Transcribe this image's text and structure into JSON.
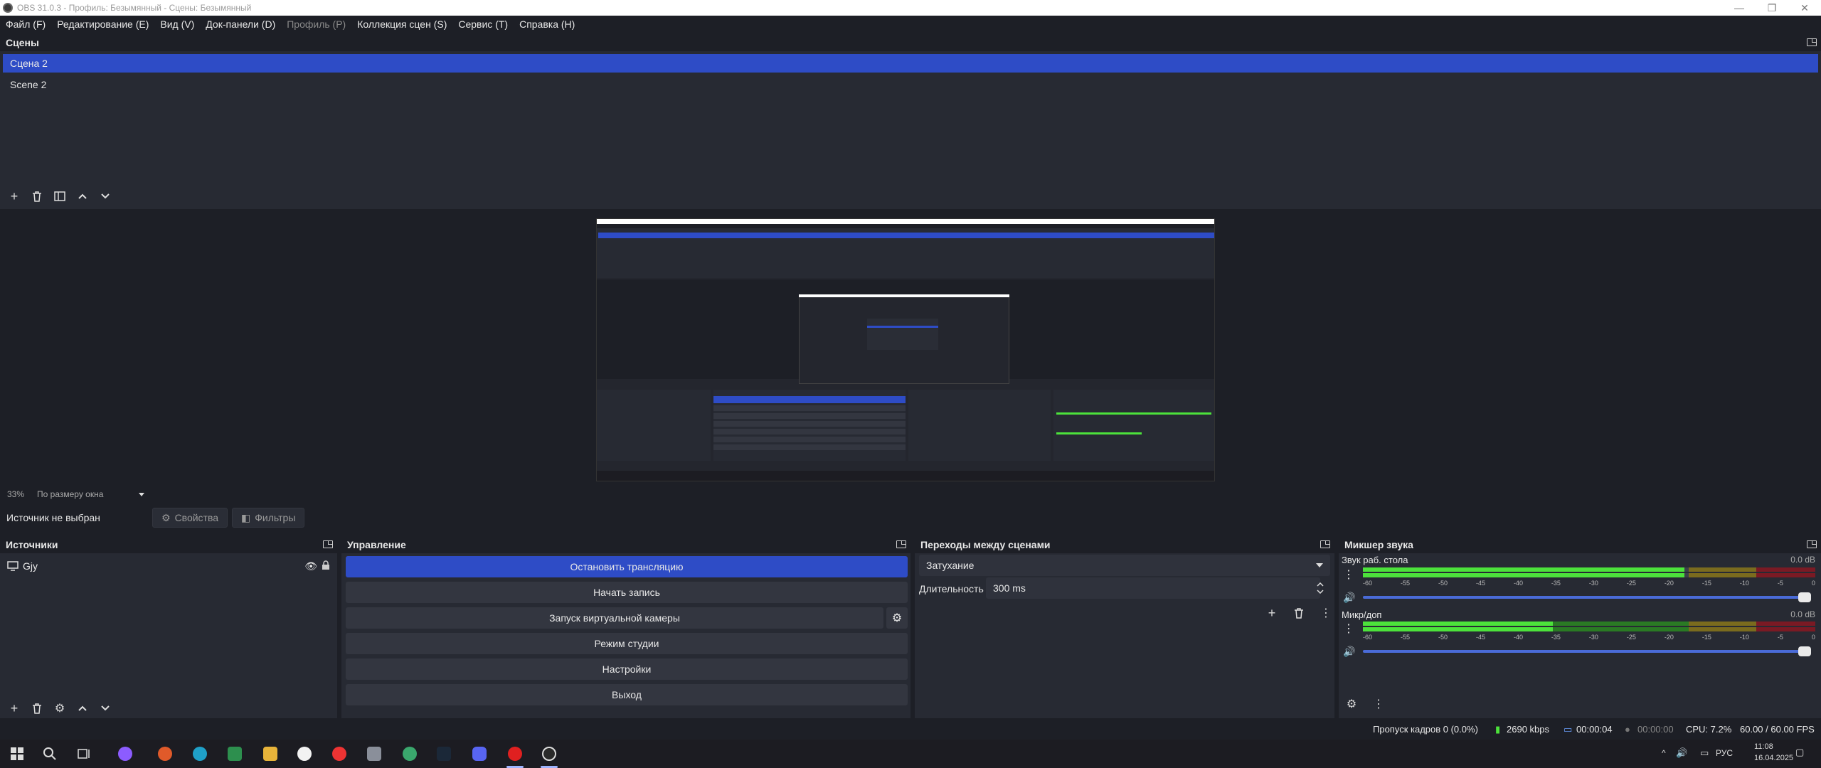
{
  "window": {
    "title": "OBS 31.0.3 - Профиль: Безымянный - Сцены: Безымянный"
  },
  "menu": [
    "Файл (F)",
    "Редактирование (E)",
    "Вид (V)",
    "Док-панели (D)",
    "Профиль (P)",
    "Коллекция сцен (S)",
    "Сервис (T)",
    "Справка (H)"
  ],
  "scenes": {
    "title": "Сцены",
    "items": [
      "Сцена 2",
      "Scene 2"
    ],
    "selected": "Сцена 2"
  },
  "preview": {
    "zoom": "33%",
    "zoom_mode": "По размеру окна"
  },
  "context": {
    "label": "Источник не выбран",
    "properties": "Свойства",
    "filters": "Фильтры"
  },
  "sources": {
    "title": "Источники",
    "items": [
      "Gjy"
    ]
  },
  "controls": {
    "title": "Управление",
    "stop_stream": "Остановить трансляцию",
    "start_record": "Начать запись",
    "virtual_cam": "Запуск виртуальной камеры",
    "studio_mode": "Режим студии",
    "settings": "Настройки",
    "exit": "Выход"
  },
  "transitions": {
    "title": "Переходы между сценами",
    "selected": "Затухание",
    "duration_label": "Длительность",
    "duration_value": "300 ms"
  },
  "mixer": {
    "title": "Микшер звука",
    "channels": [
      {
        "name": "Звук раб. стола",
        "db": "0.0 dB",
        "level": 0.71
      },
      {
        "name": "Микр/доп",
        "db": "0.0 dB",
        "level": 0.42
      }
    ],
    "ticks": [
      "-60",
      "-55",
      "-50",
      "-45",
      "-40",
      "-35",
      "-30",
      "-25",
      "-20",
      "-15",
      "-10",
      "-5",
      "0"
    ]
  },
  "status": {
    "dropped": "Пропуск кадров 0 (0.0%)",
    "bitrate": "2690 kbps",
    "stream_time": "00:00:04",
    "rec_time": "00:00:00",
    "cpu": "CPU: 7.2%",
    "fps": "60.00 / 60.00 FPS"
  },
  "taskbar": {
    "lang": "РУС",
    "time": "11:08",
    "date": "16.04.2025"
  }
}
